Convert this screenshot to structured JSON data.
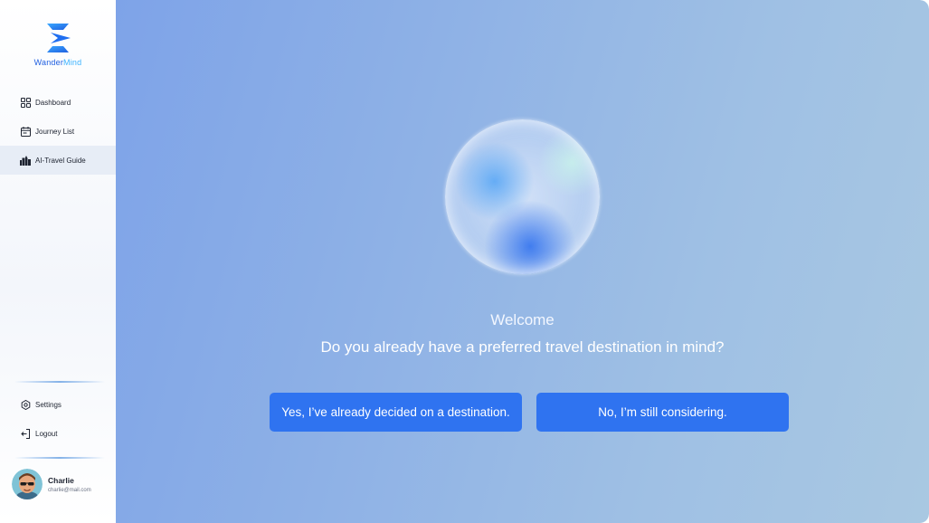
{
  "brand": {
    "name_part1": "Wander",
    "name_part2": "Mind"
  },
  "sidebar": {
    "items": [
      {
        "label": "Dashboard",
        "icon": "grid-icon"
      },
      {
        "label": "Journey List",
        "icon": "calendar-icon"
      },
      {
        "label": "AI-Travel Guide",
        "icon": "city-icon",
        "active": true
      }
    ],
    "bottom_items": [
      {
        "label": "Settings",
        "icon": "gear-icon"
      },
      {
        "label": "Logout",
        "icon": "logout-icon"
      }
    ]
  },
  "user": {
    "name": "Charlie",
    "email": "charlie@mail.com"
  },
  "main": {
    "welcome": "Welcome",
    "question": "Do you already have a preferred travel destination in mind?",
    "buttons": {
      "yes": "Yes, I’ve already decided on a destination.",
      "no": "No, I’m still considering."
    }
  },
  "colors": {
    "accent": "#2f73f0",
    "brand": "#1f5fe0",
    "sidebar_active": "#e7edf6"
  }
}
